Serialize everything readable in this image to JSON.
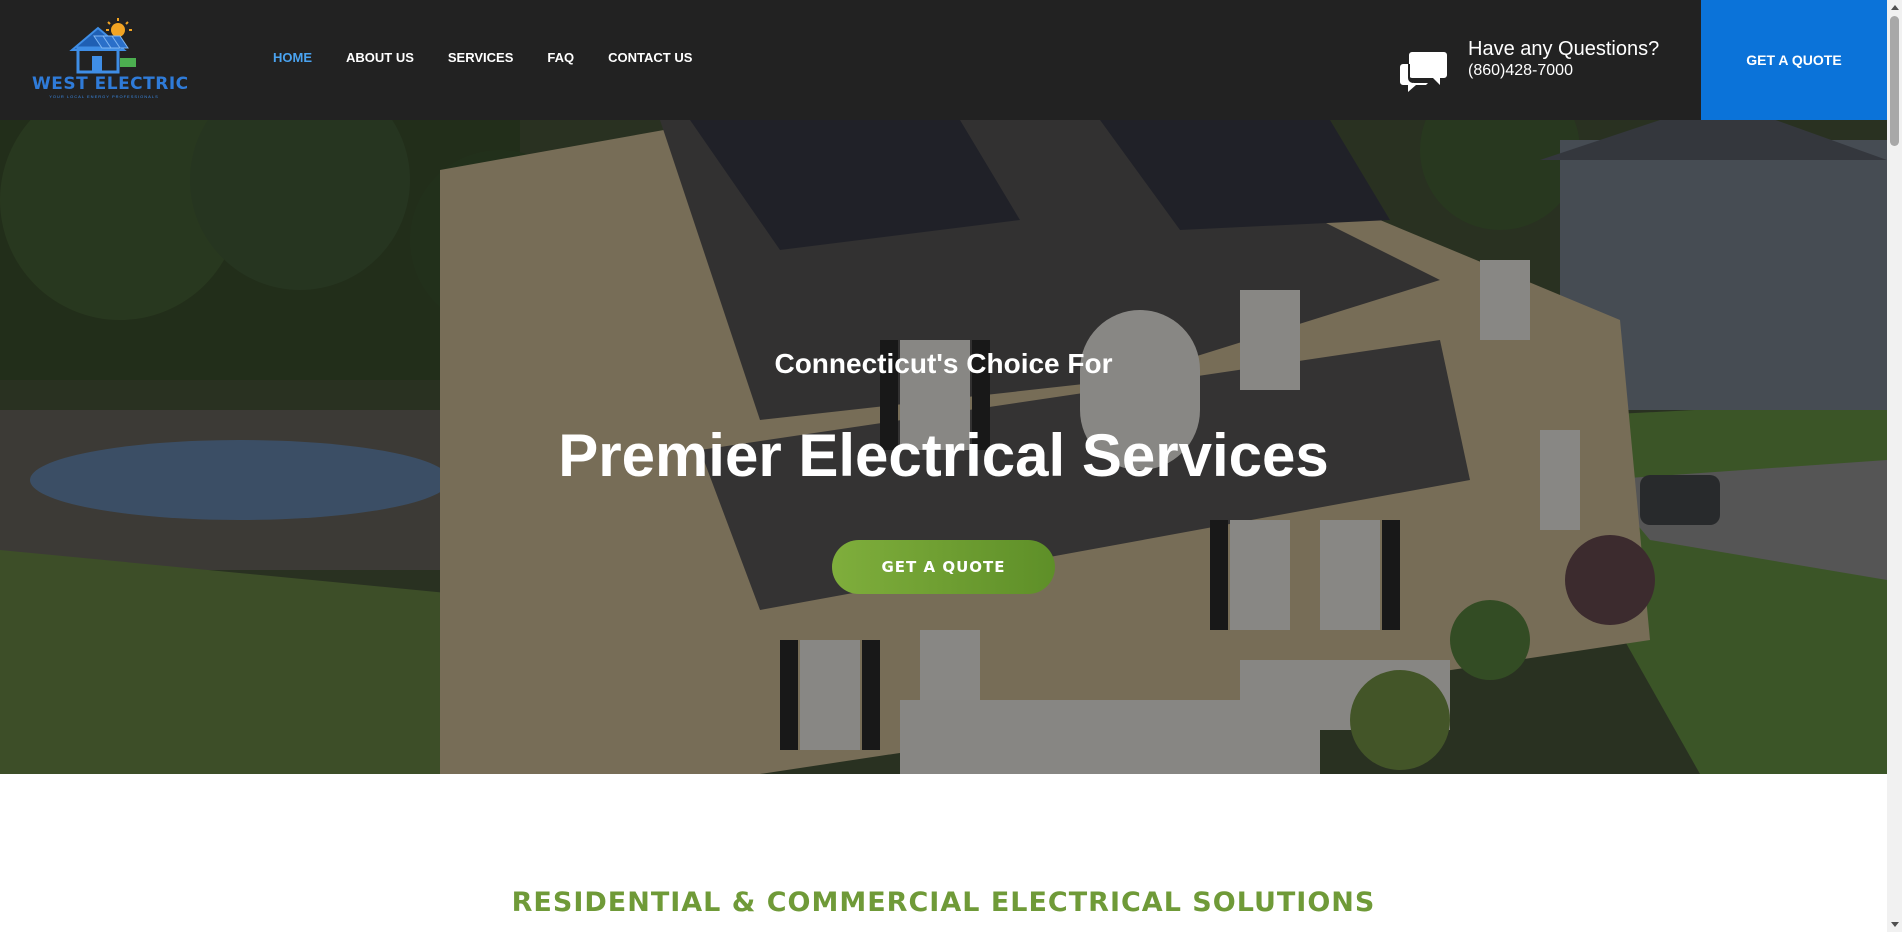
{
  "header": {
    "logo": {
      "name": "WEST ELECTRIC",
      "tagline": "YOUR LOCAL ENERGY PROFESSIONALS",
      "icon": "house-solar-logo-icon"
    },
    "nav": [
      {
        "label": "HOME",
        "active": true
      },
      {
        "label": "ABOUT US",
        "active": false
      },
      {
        "label": "SERVICES",
        "active": false
      },
      {
        "label": "FAQ",
        "active": false
      },
      {
        "label": "CONTACT US",
        "active": false
      }
    ],
    "contact": {
      "icon": "chat-bubbles-icon",
      "title": "Have any Questions?",
      "phone": "(860)428-7000"
    },
    "cta_label": "GET A QUOTE"
  },
  "hero": {
    "subtitle": "Connecticut's Choice For",
    "title": "Premier Electrical Services",
    "cta_label": "GET A QUOTE"
  },
  "section": {
    "title": "RESIDENTIAL & COMMERCIAL ELECTRICAL SOLUTIONS"
  },
  "colors": {
    "header_bg": "#222222",
    "nav_active": "#4aa3f0",
    "header_cta_bg": "#0b73d9",
    "hero_cta_bg": "#6f9e32",
    "section_title": "#6f9a38"
  }
}
